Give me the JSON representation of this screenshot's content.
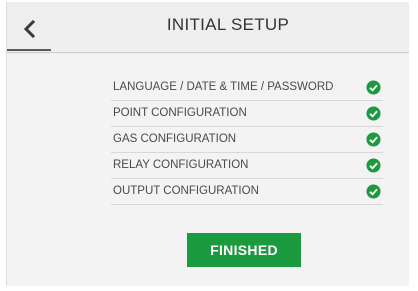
{
  "header": {
    "title": "INITIAL SETUP",
    "back_icon": "chevron-left-icon"
  },
  "setup": {
    "check_icon": "check-circle-icon",
    "check_color": "#1b9a3f",
    "items": [
      {
        "label": "LANGUAGE / DATE & TIME / PASSWORD",
        "status": "complete"
      },
      {
        "label": "POINT CONFIGURATION",
        "status": "complete"
      },
      {
        "label": "GAS CONFIGURATION",
        "status": "complete"
      },
      {
        "label": "RELAY CONFIGURATION",
        "status": "complete"
      },
      {
        "label": "OUTPUT CONFIGURATION",
        "status": "complete"
      }
    ]
  },
  "footer": {
    "finished_label": "FINISHED",
    "finished_color": "#1b9a3f"
  }
}
